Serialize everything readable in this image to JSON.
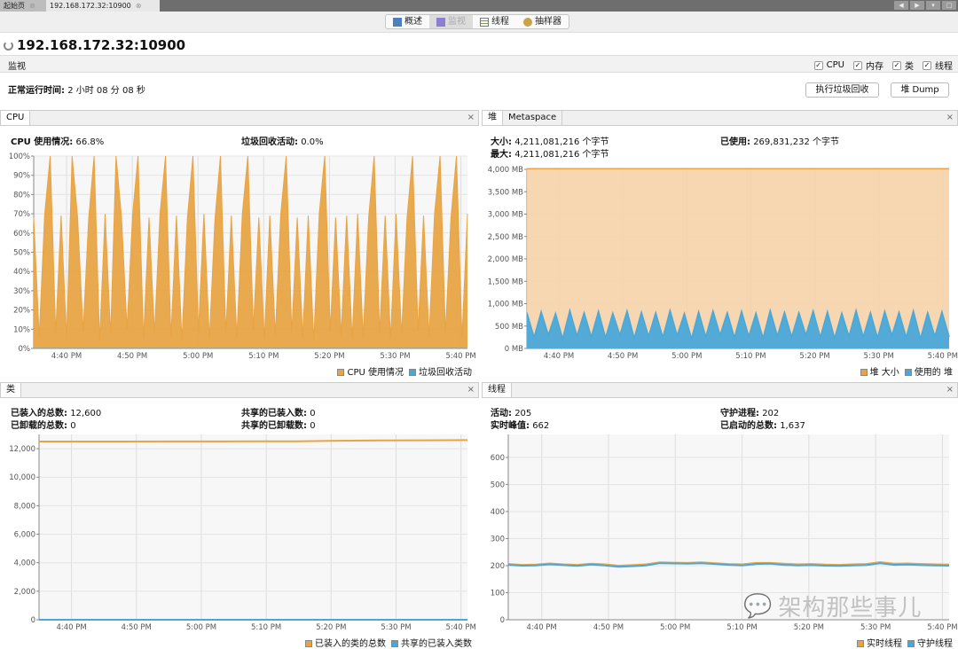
{
  "tabs": [
    {
      "label": "起始页"
    },
    {
      "label": "192.168.172.32:10900"
    }
  ],
  "view_tabs": [
    {
      "label": "概述",
      "icon": "overview-icon"
    },
    {
      "label": "监视",
      "icon": "monitor-icon",
      "active": true
    },
    {
      "label": "线程",
      "icon": "threads-icon"
    },
    {
      "label": "抽样器",
      "icon": "sampler-icon"
    }
  ],
  "title": "192.168.172.32:10900",
  "monitor": {
    "label": "监视",
    "checks": [
      {
        "label": "CPU",
        "checked": true
      },
      {
        "label": "内存",
        "checked": true
      },
      {
        "label": "类",
        "checked": true
      },
      {
        "label": "线程",
        "checked": true
      }
    ]
  },
  "uptime": {
    "label": "正常运行时间:",
    "value": "2 小时 08 分 08 秒"
  },
  "buttons": {
    "gc": "执行垃圾回收",
    "dump": "堆 Dump"
  },
  "colors": {
    "orange": "#e8a444",
    "blue": "#4aa8d8",
    "heap_fill": "#f5d3a8"
  },
  "cpu_panel": {
    "title": "CPU",
    "usage_label": "CPU 使用情况:",
    "usage": "66.8%",
    "gc_label": "垃圾回收活动:",
    "gc": "0.0%",
    "legend": [
      "CPU 使用情况",
      "垃圾回收活动"
    ]
  },
  "heap_panel": {
    "tabs": [
      "堆",
      "Metaspace"
    ],
    "size_label": "大小:",
    "size": "4,211,081,216 个字节",
    "max_label": "最大:",
    "max": "4,211,081,216 个字节",
    "used_label": "已使用:",
    "used": "269,831,232 个字节",
    "legend": [
      "堆 大小",
      "使用的 堆"
    ]
  },
  "class_panel": {
    "title": "类",
    "loaded_label": "已装入的总数:",
    "loaded": "12,600",
    "unloaded_label": "已卸载的总数:",
    "unloaded": "0",
    "shared_loaded_label": "共享的已装入数:",
    "shared_loaded": "0",
    "shared_unloaded_label": "共享的已卸载数:",
    "shared_unloaded": "0",
    "legend": [
      "已装入的类的总数",
      "共享的已装入类数"
    ]
  },
  "thread_panel": {
    "title": "线程",
    "live_label": "活动:",
    "live": "205",
    "peak_label": "实时峰值:",
    "peak": "662",
    "daemon_label": "守护进程:",
    "daemon": "202",
    "started_label": "已启动的总数:",
    "started": "1,637",
    "legend": [
      "实时线程",
      "守护线程"
    ]
  },
  "watermark": "架构那些事儿",
  "chart_data": [
    {
      "type": "area",
      "id": "cpu",
      "x_range": [
        "4:35 PM",
        "5:41 PM"
      ],
      "ylim": [
        0,
        100
      ],
      "yticks": [
        "0%",
        "10%",
        "20%",
        "30%",
        "40%",
        "50%",
        "60%",
        "70%",
        "80%",
        "90%",
        "100%"
      ],
      "xticks": [
        "4:40 PM",
        "4:50 PM",
        "5:00 PM",
        "5:10 PM",
        "5:20 PM",
        "5:30 PM",
        "5:40 PM"
      ],
      "grid": true,
      "legend": "bottom-right",
      "series": [
        {
          "name": "CPU 使用情况",
          "values": [
            68,
            6,
            70,
            100,
            8,
            69,
            5,
            100,
            68,
            9,
            67,
            100,
            4,
            70,
            7,
            100,
            68,
            10,
            69,
            100,
            5,
            68,
            8,
            70,
            100,
            6,
            69,
            4,
            68,
            100,
            9,
            70,
            5,
            67,
            100,
            8,
            69,
            6,
            70,
            100,
            10,
            68,
            5,
            69,
            7,
            70,
            100,
            8,
            68,
            6,
            69,
            4,
            70,
            100,
            9,
            68,
            7,
            69,
            5,
            70,
            6,
            68,
            100,
            8,
            69,
            5,
            70,
            7,
            68,
            100,
            9,
            69,
            6,
            70,
            100,
            8,
            68,
            100,
            5,
            70
          ]
        },
        {
          "name": "垃圾回收活动",
          "values": [
            0,
            0,
            0,
            0,
            0,
            0,
            0,
            0,
            0,
            0
          ]
        }
      ]
    },
    {
      "type": "area",
      "id": "heap",
      "x_range": [
        "4:35 PM",
        "5:41 PM"
      ],
      "ylim": [
        0,
        4000
      ],
      "yticks": [
        "0 MB",
        "500 MB",
        "1,000 MB",
        "1,500 MB",
        "2,000 MB",
        "2,500 MB",
        "3,000 MB",
        "3,500 MB",
        "4,000 MB"
      ],
      "xticks": [
        "4:40 PM",
        "4:50 PM",
        "5:00 PM",
        "5:10 PM",
        "5:20 PM",
        "5:30 PM",
        "5:40 PM"
      ],
      "grid": true,
      "legend": "bottom-right",
      "series": [
        {
          "name": "堆 大小",
          "values": [
            4016,
            4016
          ]
        },
        {
          "name": "使用的 堆",
          "values": [
            800,
            250,
            820,
            300,
            780,
            220,
            850,
            280,
            800,
            260,
            830,
            240,
            790,
            300,
            840,
            230,
            810,
            270,
            800,
            250,
            850,
            290,
            780,
            220,
            820,
            260,
            840,
            300,
            800,
            240,
            830,
            270,
            790,
            230,
            850,
            280,
            810,
            260,
            800,
            300,
            840,
            250,
            820,
            230,
            790,
            270,
            850,
            260,
            800,
            240,
            830,
            290,
            810,
            250,
            840,
            220,
            800,
            270,
            820,
            260
          ]
        }
      ]
    },
    {
      "type": "line",
      "id": "classes",
      "x_range": [
        "4:35 PM",
        "5:41 PM"
      ],
      "ylim": [
        0,
        13000
      ],
      "yticks": [
        "0",
        "2,000",
        "4,000",
        "6,000",
        "8,000",
        "10,000",
        "12,000"
      ],
      "xticks": [
        "4:40 PM",
        "4:50 PM",
        "5:00 PM",
        "5:10 PM",
        "5:20 PM",
        "5:30 PM",
        "5:40 PM"
      ],
      "grid": true,
      "legend": "bottom-right",
      "series": [
        {
          "name": "已装入的类的总数",
          "values": [
            12500,
            12500,
            12500,
            12510,
            12510,
            12520,
            12520,
            12560,
            12580,
            12590,
            12600
          ]
        },
        {
          "name": "共享的已装入类数",
          "values": [
            0,
            0,
            0,
            0,
            0,
            0,
            0,
            0,
            0,
            0,
            0
          ]
        }
      ]
    },
    {
      "type": "line",
      "id": "threads",
      "x_range": [
        "4:35 PM",
        "5:41 PM"
      ],
      "ylim": [
        0,
        685
      ],
      "yticks": [
        "0",
        "100",
        "200",
        "300",
        "400",
        "500",
        "600"
      ],
      "xticks": [
        "4:40 PM",
        "4:50 PM",
        "5:00 PM",
        "5:10 PM",
        "5:20 PM",
        "5:30 PM",
        "5:40 PM"
      ],
      "grid": true,
      "legend": "bottom-right",
      "series": [
        {
          "name": "实时线程",
          "values": [
            206,
            203,
            204,
            208,
            205,
            203,
            207,
            205,
            200,
            202,
            205,
            212,
            211,
            210,
            212,
            209,
            206,
            205,
            210,
            210,
            207,
            205,
            206,
            204,
            203,
            205,
            206,
            213,
            207,
            208,
            206,
            205,
            204
          ]
        },
        {
          "name": "守护线程",
          "values": [
            203,
            200,
            201,
            205,
            202,
            199,
            204,
            201,
            196,
            198,
            201,
            209,
            208,
            207,
            209,
            206,
            203,
            201,
            206,
            207,
            203,
            201,
            202,
            200,
            199,
            201,
            202,
            209,
            203,
            204,
            202,
            201,
            200
          ]
        }
      ]
    }
  ]
}
